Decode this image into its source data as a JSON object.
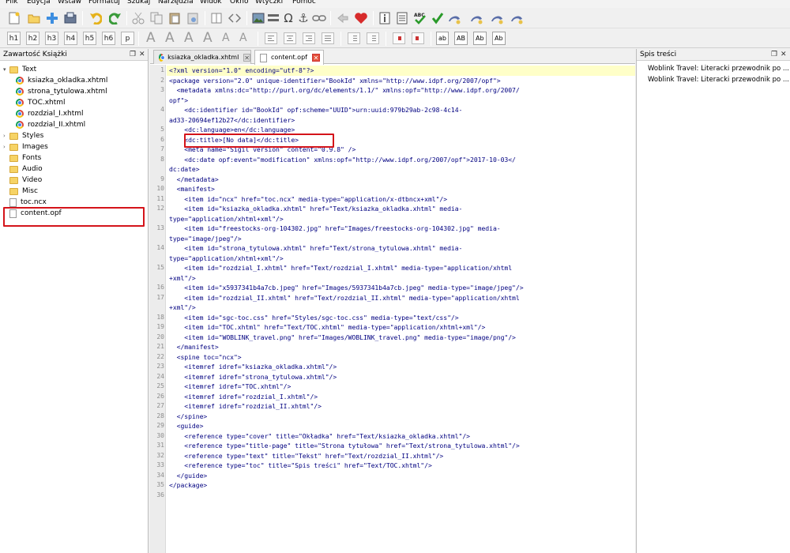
{
  "menu": [
    "Plik",
    "Edycja",
    "Wstaw",
    "Formatuj",
    "Szukaj",
    "Narzędzia",
    "Widok",
    "Okno",
    "Wtyczki",
    "Pomoc"
  ],
  "heading_buttons": [
    "h1",
    "h2",
    "h3",
    "h4",
    "h5",
    "h6",
    "p"
  ],
  "case_buttons": [
    "ab",
    "AB",
    "Ab",
    "Ab"
  ],
  "left_panel": {
    "title": "Zawartość Książki",
    "items": [
      {
        "label": "Text",
        "type": "folder-open"
      },
      {
        "label": "ksiazka_okladka.xhtml",
        "type": "html"
      },
      {
        "label": "strona_tytulowa.xhtml",
        "type": "html"
      },
      {
        "label": "TOC.xhtml",
        "type": "html"
      },
      {
        "label": "rozdzial_I.xhtml",
        "type": "html"
      },
      {
        "label": "rozdzial_II.xhtml",
        "type": "html"
      },
      {
        "label": "Styles",
        "type": "folder"
      },
      {
        "label": "Images",
        "type": "folder"
      },
      {
        "label": "Fonts",
        "type": "folder"
      },
      {
        "label": "Audio",
        "type": "folder"
      },
      {
        "label": "Video",
        "type": "folder"
      },
      {
        "label": "Misc",
        "type": "folder"
      },
      {
        "label": "toc.ncx",
        "type": "file"
      },
      {
        "label": "content.opf",
        "type": "file",
        "selected": true
      }
    ]
  },
  "tabs": [
    {
      "label": "ksiazka_okladka.xhtml",
      "active": false
    },
    {
      "label": "content.opf",
      "active": true
    }
  ],
  "right_panel": {
    "title": "Spis treści",
    "items": [
      "Woblink Travel: Literacki przewodnik po ...",
      "Woblink Travel: Literacki przewodnik po ..."
    ]
  },
  "code": {
    "highlight_color": "#ffffc8",
    "lines": [
      {
        "n": "1",
        "text": "<?xml version=\"1.0\" encoding=\"utf-8\"?>"
      },
      {
        "n": "2",
        "text": "<package version=\"2.0\" unique-identifier=\"BookId\" xmlns=\"http://www.idpf.org/2007/opf\">"
      },
      {
        "n": "3",
        "text": "  <metadata xmlns:dc=\"http://purl.org/dc/elements/1.1/\" xmlns:opf=\"http://www.idpf.org/2007/"
      },
      {
        "n": "",
        "text": "opf\">"
      },
      {
        "n": "4",
        "text": "    <dc:identifier id=\"BookId\" opf:scheme=\"UUID\">urn:uuid:979b29ab-2c98-4c14-"
      },
      {
        "n": "",
        "text": "ad33-20694ef12b27</dc:identifier>"
      },
      {
        "n": "5",
        "text": "    <dc:language>en</dc:language>"
      },
      {
        "n": "6",
        "text": "    <dc:title>[No data]</dc:title>"
      },
      {
        "n": "7",
        "text": "    <meta name=\"Sigil version\" content=\"0.9.8\" />"
      },
      {
        "n": "8",
        "text": "    <dc:date opf:event=\"modification\" xmlns:opf=\"http://www.idpf.org/2007/opf\">2017-10-03</"
      },
      {
        "n": "",
        "text": "dc:date>"
      },
      {
        "n": "9",
        "text": "  </metadata>"
      },
      {
        "n": "10",
        "text": "  <manifest>"
      },
      {
        "n": "11",
        "text": "    <item id=\"ncx\" href=\"toc.ncx\" media-type=\"application/x-dtbncx+xml\"/>"
      },
      {
        "n": "12",
        "text": "    <item id=\"ksiazka_okladka.xhtml\" href=\"Text/ksiazka_okladka.xhtml\" media-"
      },
      {
        "n": "",
        "text": "type=\"application/xhtml+xml\"/>"
      },
      {
        "n": "13",
        "text": "    <item id=\"freestocks-org-104302.jpg\" href=\"Images/freestocks-org-104302.jpg\" media-"
      },
      {
        "n": "",
        "text": "type=\"image/jpeg\"/>"
      },
      {
        "n": "14",
        "text": "    <item id=\"strona_tytulowa.xhtml\" href=\"Text/strona_tytulowa.xhtml\" media-"
      },
      {
        "n": "",
        "text": "type=\"application/xhtml+xml\"/>"
      },
      {
        "n": "15",
        "text": "    <item id=\"rozdzial_I.xhtml\" href=\"Text/rozdzial_I.xhtml\" media-type=\"application/xhtml"
      },
      {
        "n": "",
        "text": "+xml\"/>"
      },
      {
        "n": "16",
        "text": "    <item id=\"x5937341b4a7cb.jpeg\" href=\"Images/5937341b4a7cb.jpeg\" media-type=\"image/jpeg\"/>"
      },
      {
        "n": "17",
        "text": "    <item id=\"rozdzial_II.xhtml\" href=\"Text/rozdzial_II.xhtml\" media-type=\"application/xhtml"
      },
      {
        "n": "",
        "text": "+xml\"/>"
      },
      {
        "n": "18",
        "text": "    <item id=\"sgc-toc.css\" href=\"Styles/sgc-toc.css\" media-type=\"text/css\"/>"
      },
      {
        "n": "19",
        "text": "    <item id=\"TOC.xhtml\" href=\"Text/TOC.xhtml\" media-type=\"application/xhtml+xml\"/>"
      },
      {
        "n": "20",
        "text": "    <item id=\"WOBLINK_travel.png\" href=\"Images/WOBLINK_travel.png\" media-type=\"image/png\"/>"
      },
      {
        "n": "21",
        "text": "  </manifest>"
      },
      {
        "n": "22",
        "text": "  <spine toc=\"ncx\">"
      },
      {
        "n": "23",
        "text": "    <itemref idref=\"ksiazka_okladka.xhtml\"/>"
      },
      {
        "n": "24",
        "text": "    <itemref idref=\"strona_tytulowa.xhtml\"/>"
      },
      {
        "n": "25",
        "text": "    <itemref idref=\"TOC.xhtml\"/>"
      },
      {
        "n": "26",
        "text": "    <itemref idref=\"rozdzial_I.xhtml\"/>"
      },
      {
        "n": "27",
        "text": "    <itemref idref=\"rozdzial_II.xhtml\"/>"
      },
      {
        "n": "28",
        "text": "  </spine>"
      },
      {
        "n": "29",
        "text": "  <guide>"
      },
      {
        "n": "30",
        "text": "    <reference type=\"cover\" title=\"Okładka\" href=\"Text/ksiazka_okladka.xhtml\"/>"
      },
      {
        "n": "31",
        "text": "    <reference type=\"title-page\" title=\"Strona tytułowa\" href=\"Text/strona_tytulowa.xhtml\"/>"
      },
      {
        "n": "32",
        "text": "    <reference type=\"text\" title=\"Tekst\" href=\"Text/rozdzial_II.xhtml\"/>"
      },
      {
        "n": "33",
        "text": "    <reference type=\"toc\" title=\"Spis treści\" href=\"Text/TOC.xhtml\"/>"
      },
      {
        "n": "34",
        "text": "  </guide>"
      },
      {
        "n": "35",
        "text": "</package>"
      },
      {
        "n": "36",
        "text": ""
      }
    ]
  },
  "colors": {
    "highlight_box": "#d4141a",
    "tag": "#000080",
    "attr_value": "#a020a0"
  }
}
